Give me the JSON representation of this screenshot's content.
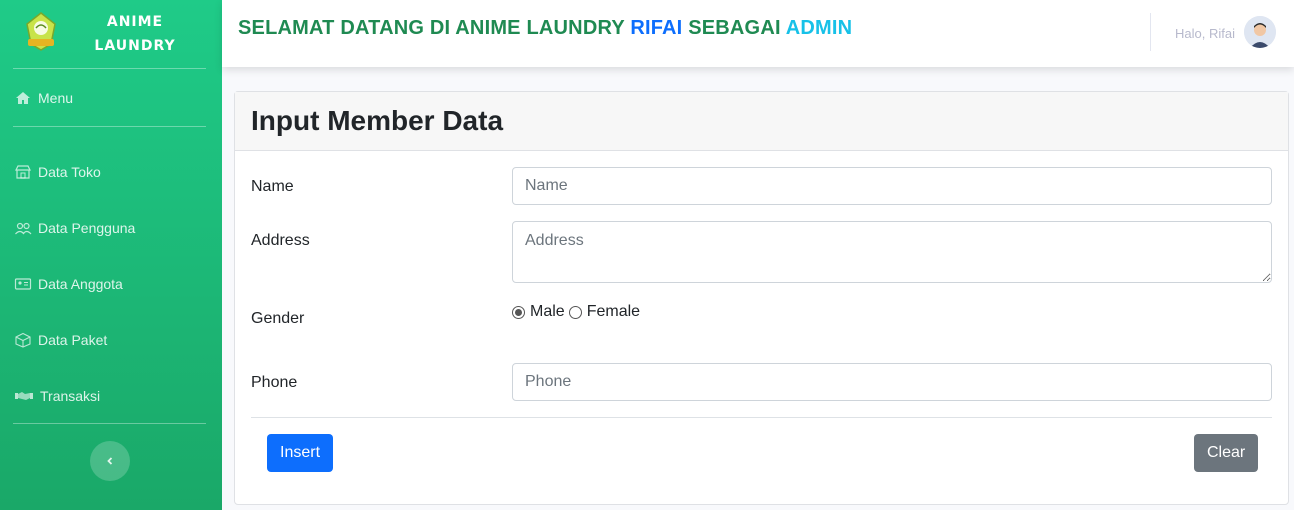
{
  "sidebar": {
    "brand_line1": "ANIME",
    "brand_line2": "LAUNDRY",
    "menu_label": "Menu",
    "items": [
      {
        "label": "Data Toko",
        "icon": "store-icon"
      },
      {
        "label": "Data Pengguna",
        "icon": "users-icon"
      },
      {
        "label": "Data Anggota",
        "icon": "id-card-icon"
      },
      {
        "label": "Data Paket",
        "icon": "box-icon"
      },
      {
        "label": "Transaksi",
        "icon": "handshake-icon"
      }
    ],
    "toggle_icon": "chevron-left-icon"
  },
  "topbar": {
    "welcome_prefix": "SELAMAT DATANG DI ANIME LAUNDRY ",
    "welcome_user": "RIFAI",
    "welcome_middle": " SEBAGAI ",
    "welcome_role": "ADMIN",
    "greeting": "Halo, Rifai"
  },
  "form": {
    "title": "Input Member Data",
    "name_label": "Name",
    "name_placeholder": "Name",
    "address_label": "Address",
    "address_placeholder": "Address",
    "gender_label": "Gender",
    "gender_options": [
      "Male",
      "Female"
    ],
    "gender_selected": "Male",
    "phone_label": "Phone",
    "phone_placeholder": "Phone",
    "insert_label": "Insert",
    "clear_label": "Clear"
  },
  "colors": {
    "sidebar_top": "#1fcb88",
    "sidebar_bottom": "#1aa868",
    "welcome_green": "#1f8a52",
    "welcome_blue": "#0d6efd",
    "welcome_cyan": "#17c1e8",
    "insert_button": "#0d6efd",
    "clear_button": "#6c757d"
  }
}
